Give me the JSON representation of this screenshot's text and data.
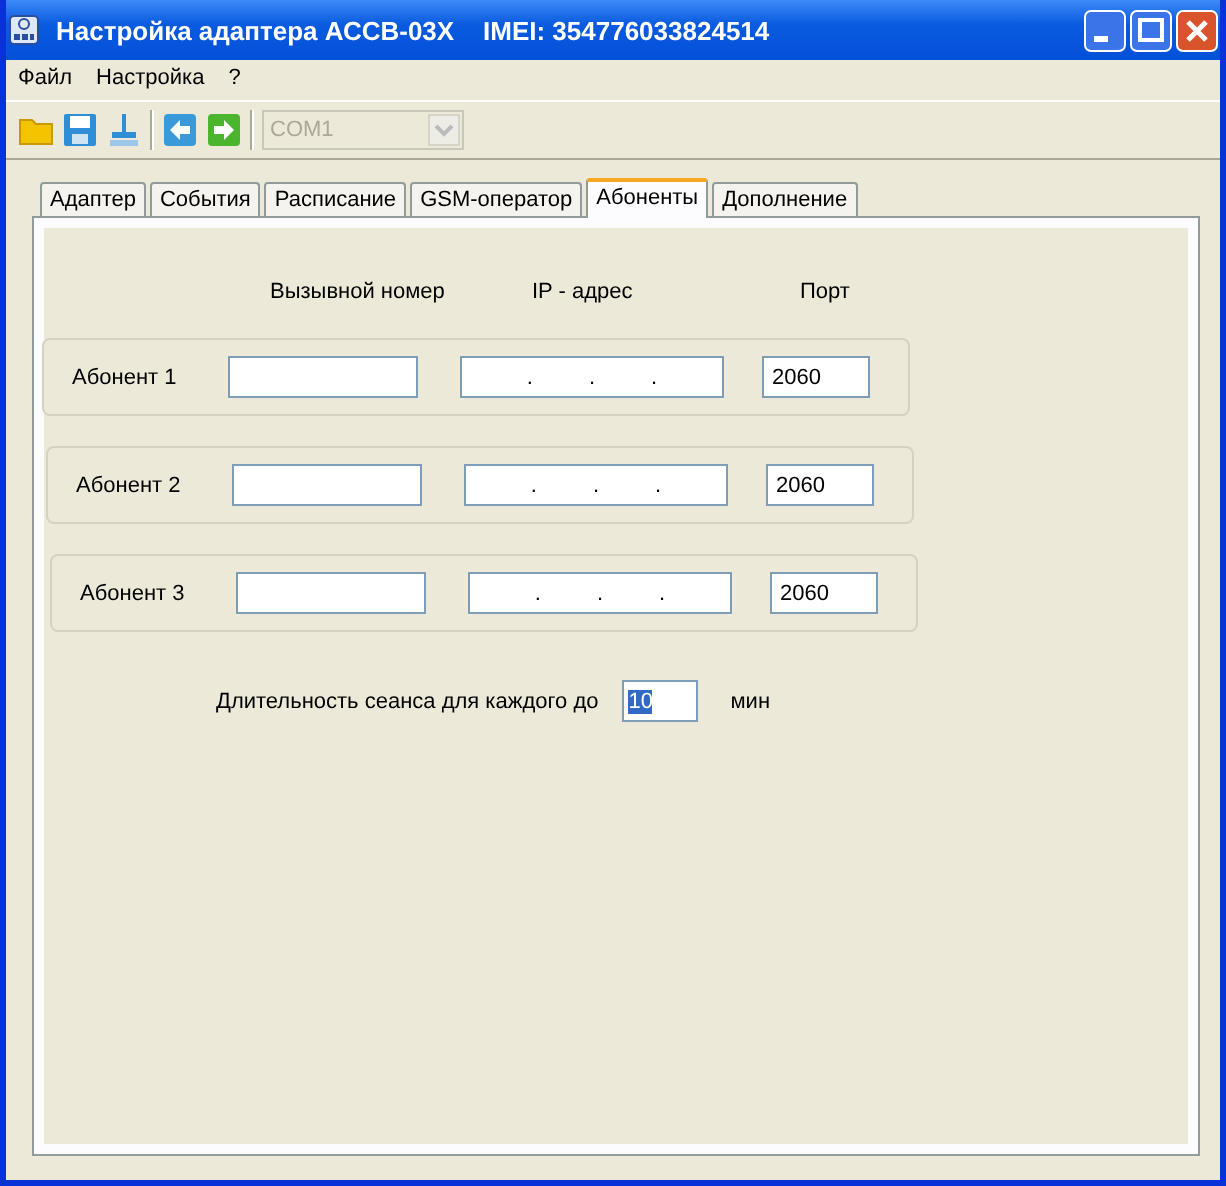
{
  "window": {
    "title": "Настройка адаптера АССВ-03Х    IMEI: 354776033824514"
  },
  "menu": [
    "Файл",
    "Настройка",
    "?"
  ],
  "toolbar": {
    "port": {
      "value": "COM1",
      "disabled": true
    }
  },
  "tabs": [
    {
      "label": "Адаптер",
      "selected": false
    },
    {
      "label": "События",
      "selected": false
    },
    {
      "label": "Расписание",
      "selected": false
    },
    {
      "label": "GSM-оператор",
      "selected": false
    },
    {
      "label": "Абоненты",
      "selected": true
    },
    {
      "label": "Дополнение",
      "selected": false
    }
  ],
  "columns": [
    "Вызывной номер",
    "IP - адрес",
    "Порт"
  ],
  "subscribers": [
    {
      "label": "Абонент 1",
      "ip": [
        ".",
        ".",
        "."
      ],
      "port": "2060"
    },
    {
      "label": "Абонент 2",
      "ip": [
        ".",
        ".",
        "."
      ],
      "port": "2060"
    },
    {
      "label": "Абонент 3",
      "ip": [
        ".",
        ".",
        "."
      ],
      "port": "2060"
    }
  ],
  "session": {
    "label": "Длительность сеанса для каждого до",
    "value": "10",
    "text_selected": true,
    "unit": "мин"
  }
}
